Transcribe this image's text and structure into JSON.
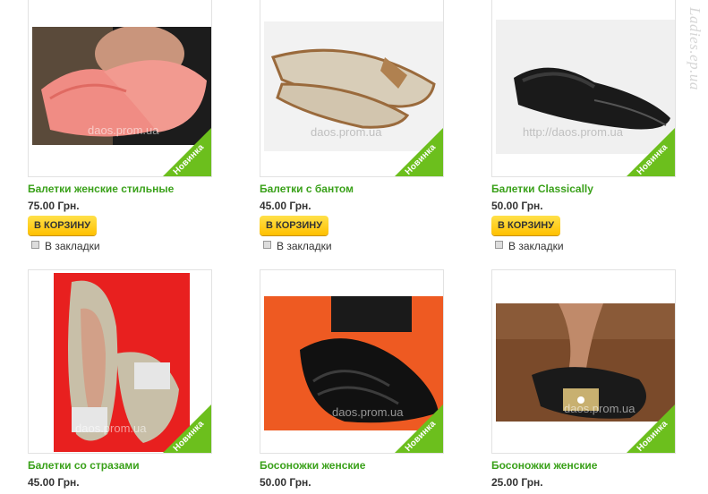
{
  "watermark": "Ladies.ep.ua",
  "badge_label": "Новинка",
  "bookmark_label": "В закладки",
  "cart_label": "В КОРЗИНУ",
  "colors": {
    "title_green": "#3aa11a",
    "badge_green": "#6cbf1d",
    "button_yellow": "#ffc000"
  },
  "products": [
    {
      "title": "Балетки женские стильные",
      "price": "75.00 Грн.",
      "watermark": "daos.prom.ua",
      "image": "pink-perforated-flats"
    },
    {
      "title": "Балетки с бантом",
      "price": "45.00 Грн.",
      "watermark": "daos.prom.ua",
      "image": "linen-flats-with-bow"
    },
    {
      "title": "Балетки Classically",
      "price": "50.00 Грн.",
      "watermark": "http://daos.prom.ua",
      "image": "black-leather-flats"
    },
    {
      "title": "Балетки со стразами",
      "price": "45.00 Грн.",
      "watermark": "daos.prom.ua",
      "image": "floral-flats-with-rhinestones"
    },
    {
      "title": "Босоножки женские",
      "price": "50.00 Грн.",
      "watermark": "daos.prom.ua",
      "image": "black-strap-sandals"
    },
    {
      "title": "Босоножки женские",
      "price": "25.00 Грн.",
      "watermark": "daos.prom.ua",
      "image": "black-sequin-peep-toe-flats"
    }
  ]
}
